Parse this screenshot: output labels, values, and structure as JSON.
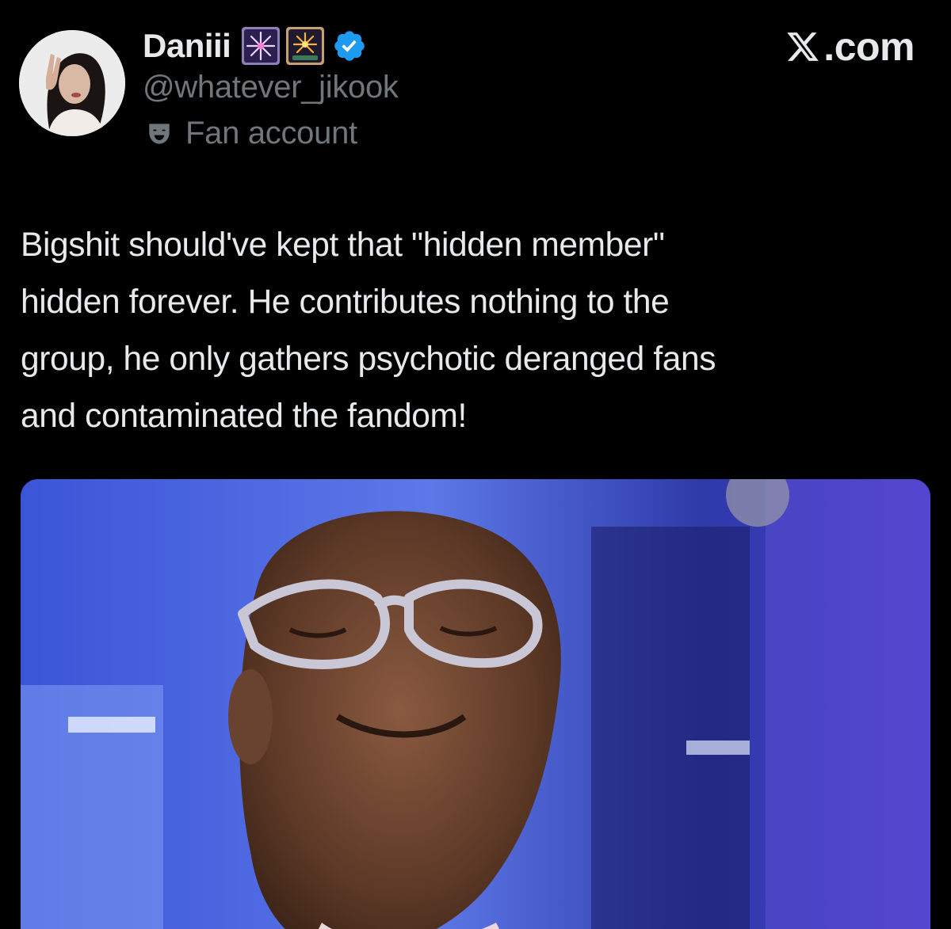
{
  "user": {
    "display_name": "Daniii",
    "handle": "@whatever_jikook",
    "label_icon": "theater-masks-icon",
    "label": "Fan account",
    "verified": true,
    "verified_color": "#1d9bf0",
    "name_emojis": [
      "fireworks-icon",
      "firework-sparkler-icon"
    ],
    "avatar": "profile-photo"
  },
  "brand": {
    "mark_icon": "x-logo-icon",
    "suffix": ".com"
  },
  "tweet": {
    "text": "Bigshit should've kept that \"hidden member\"\nhidden forever. He contributes nothing to the\ngroup, he only gathers psychotic deranged fans\nand contaminated the fandom!"
  },
  "media": {
    "kind": "animated-gif-reaction",
    "subject": "man-with-glasses-smiling-upward"
  },
  "colors": {
    "background": "#000000",
    "text_primary": "#e7e9ea",
    "text_secondary": "#71767b",
    "accent": "#1d9bf0"
  }
}
